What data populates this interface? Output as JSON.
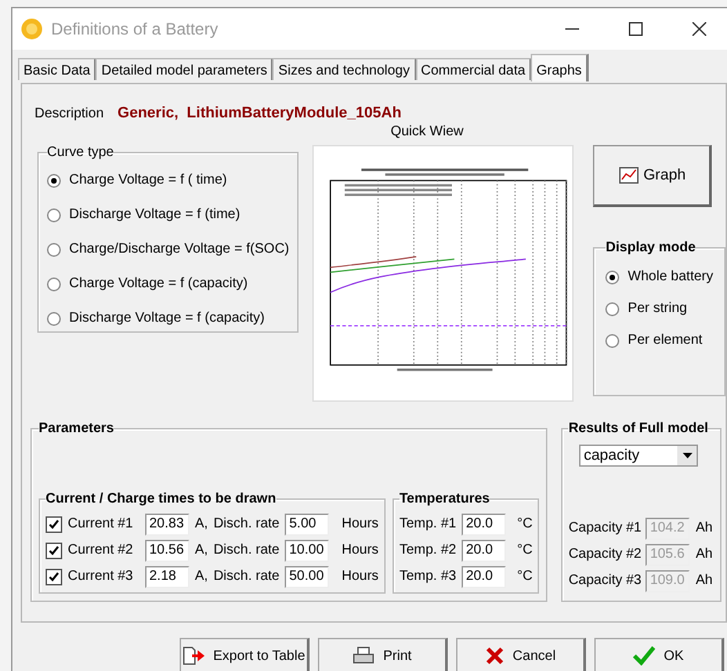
{
  "window": {
    "title": "Definitions of a Battery"
  },
  "tabs": [
    {
      "label": "Basic Data",
      "selected": false
    },
    {
      "label": "Detailed model parameters",
      "selected": false
    },
    {
      "label": "Sizes and technology",
      "selected": false
    },
    {
      "label": "Commercial data",
      "selected": false
    },
    {
      "label": "Graphs",
      "selected": true
    }
  ],
  "description": {
    "label": "Description",
    "value": "Generic,  LithiumBatteryModule_105Ah"
  },
  "quick_view": {
    "title": "Quick Wiew"
  },
  "curve_type": {
    "title": "Curve type",
    "options": [
      {
        "label": "Charge Voltage = f ( time)",
        "selected": true
      },
      {
        "label": "Discharge Voltage =  f (time)",
        "selected": false
      },
      {
        "label": "Charge/Discharge Voltage = f(SOC)",
        "selected": false
      },
      {
        "label": "Charge Voltage = f (capacity)",
        "selected": false
      },
      {
        "label": "Discharge Voltage = f (capacity)",
        "selected": false
      }
    ]
  },
  "graph_button": {
    "label": "Graph"
  },
  "display_mode": {
    "title": "Display mode",
    "options": [
      {
        "label": "Whole battery",
        "selected": true
      },
      {
        "label": "Per string",
        "selected": false
      },
      {
        "label": "Per element",
        "selected": false
      }
    ]
  },
  "parameters": {
    "title": "Parameters",
    "currents": {
      "title": "Current / Charge times to be drawn",
      "rows": [
        {
          "label": "Current #1",
          "checked": true,
          "current": "20.83",
          "unit": "A,",
          "rate_label": "Disch. rate",
          "rate": "5.00",
          "rate_unit": "Hours"
        },
        {
          "label": "Current #2",
          "checked": true,
          "current": "10.56",
          "unit": "A,",
          "rate_label": "Disch. rate",
          "rate": "10.00",
          "rate_unit": "Hours"
        },
        {
          "label": "Current #3",
          "checked": true,
          "current": "2.18",
          "unit": "A,",
          "rate_label": "Disch. rate",
          "rate": "50.00",
          "rate_unit": "Hours"
        }
      ]
    },
    "temperatures": {
      "title": "Temperatures",
      "rows": [
        {
          "label": "Temp. #1",
          "value": "20.0",
          "unit": "°C"
        },
        {
          "label": "Temp. #2",
          "value": "20.0",
          "unit": "°C"
        },
        {
          "label": "Temp. #3",
          "value": "20.0",
          "unit": "°C"
        }
      ]
    }
  },
  "results": {
    "title": "Results of Full model",
    "dropdown": "capacity",
    "rows": [
      {
        "label": "Capacity #1",
        "value": "104.2",
        "unit": "Ah",
        "disabled": true
      },
      {
        "label": "Capacity #2",
        "value": "105.6",
        "unit": "Ah",
        "disabled": true
      },
      {
        "label": "Capacity #3",
        "value": "109.0",
        "unit": "Ah",
        "disabled": true
      }
    ]
  },
  "buttons": [
    {
      "label": "Export to Table",
      "kind": "export"
    },
    {
      "label": "Print",
      "kind": "print"
    },
    {
      "label": "Cancel",
      "kind": "cancel"
    },
    {
      "label": "OK",
      "kind": "ok"
    }
  ]
}
